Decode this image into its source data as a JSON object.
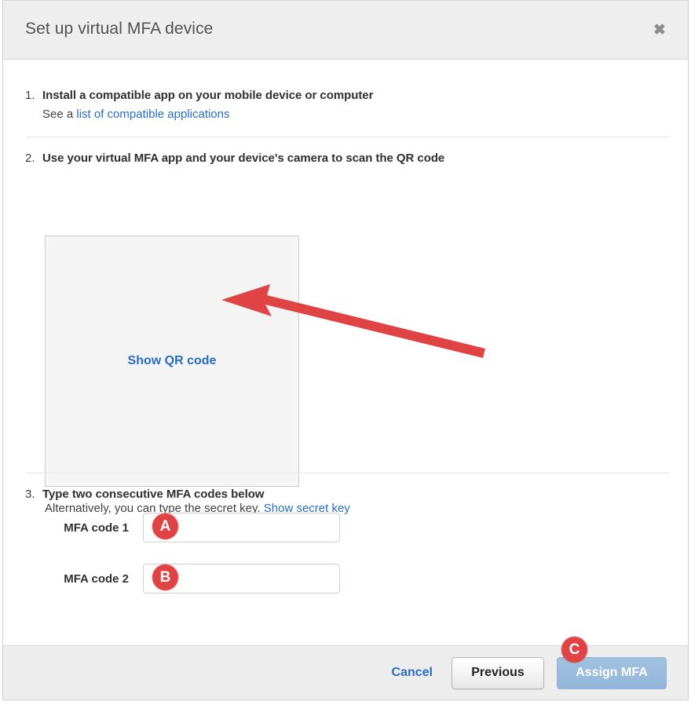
{
  "dialog": {
    "title": "Set up virtual MFA device",
    "close_icon": "close-icon"
  },
  "steps": [
    {
      "number": "1.",
      "heading": "Install a compatible app on your mobile device or computer",
      "sub_prefix": "See a ",
      "sub_link": "list of compatible applications"
    },
    {
      "number": "2.",
      "heading": "Use your virtual MFA app and your device's camera to scan the QR code",
      "qr_link": "Show QR code",
      "alt_prefix": "Alternatively, you can type the secret key. ",
      "alt_link": "Show secret key"
    },
    {
      "number": "3.",
      "heading": "Type two consecutive MFA codes below"
    }
  ],
  "form": {
    "fields": [
      {
        "label": "MFA code 1",
        "value": "",
        "placeholder": ""
      },
      {
        "label": "MFA code 2",
        "value": "",
        "placeholder": ""
      }
    ]
  },
  "annotations": {
    "badges": [
      {
        "letter": "A"
      },
      {
        "letter": "B"
      },
      {
        "letter": "C"
      }
    ],
    "arrow": {
      "color": "#e04343",
      "points_to": "Show QR code"
    }
  },
  "footer": {
    "cancel_label": "Cancel",
    "previous_label": "Previous",
    "assign_label": "Assign MFA"
  },
  "colors": {
    "accent_link": "#2a6dc0",
    "annotation_red": "#e04343",
    "header_bg": "#eeeeee",
    "footer_bg": "#ededed",
    "assign_button": "#8fb4d9"
  }
}
